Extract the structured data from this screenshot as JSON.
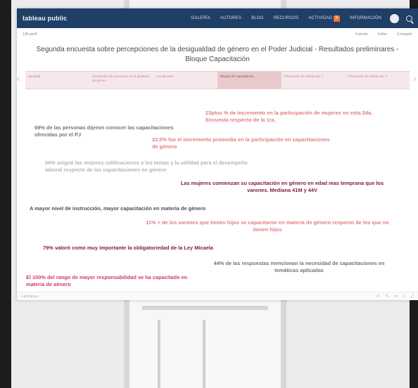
{
  "nav": {
    "brand": "tableau public",
    "items": [
      "GALERÍA",
      "AUTORES",
      "BLOG",
      "RECURSOS",
      "ACTIVIDAD",
      "INFORMACIÓN"
    ],
    "activity_badge": "6"
  },
  "subbar": {
    "views": "138 perfil",
    "actions": [
      "Favorito",
      "Editar",
      "Compartir"
    ]
  },
  "title": "Segunda encuesta sobre percepciones de la desigualdad de género en el Poder Judicial - Resultados preliminares - Bloque Capacitación",
  "tabs": [
    {
      "label": "Igualdad"
    },
    {
      "label": "Actividades de promoción de la igualdad de género"
    },
    {
      "label": "Ley Micaela"
    },
    {
      "label": "Bloque de Capacitación"
    },
    {
      "label": "Percepción de obstáculos 1"
    },
    {
      "label": "Percepción de obstáculos 2"
    }
  ],
  "statements": {
    "s1": "23ptos % de incremento en la participación de mujeres en esta 2da. Encuesta respecto de la 1ra.",
    "s2": "69% de las personas dijeron conocer las capacitaciones ofrecidas por el PJ",
    "s3": "22,5% fue el incremento promedio en la participación en capacitaciones de género",
    "s4": "59% asignó las mejores calificaciones a los temas y la utilidad para el desempeño laboral respecto de las capacitaciones en género",
    "s5": "Las mujeres comienzan su capacitación en género en edad mas temprana que los varones. Mediana 41M y 44V",
    "s6": "A mayor nivel de instrucción, mayor capacitación en materia de género",
    "s7": "11% + de los varones que tienen hijos se capacitaron en materia de género respecto de los que no tienen hijos",
    "s8": "79% valoró como muy importante la obligatoriedad de la Ley Micaela",
    "s9": "44% de las respuestas mencionan la necesidad de capacitaciones en temáticas aplicadas",
    "s10": "El 100% del rango de mayor responsabilidad se ha capacitado en materia de género"
  },
  "footer": {
    "logo": "+ableau",
    "controls": [
      "Deshacer",
      "Rehacer",
      "Restablecer",
      "Compartir",
      "Pantalla completa"
    ]
  },
  "colors": {
    "header_bg": "#1f3f66",
    "accent_orange": "#e8762d",
    "maroon": "#7c1d45",
    "rose": "#c94068",
    "pink": "#e07f86"
  }
}
